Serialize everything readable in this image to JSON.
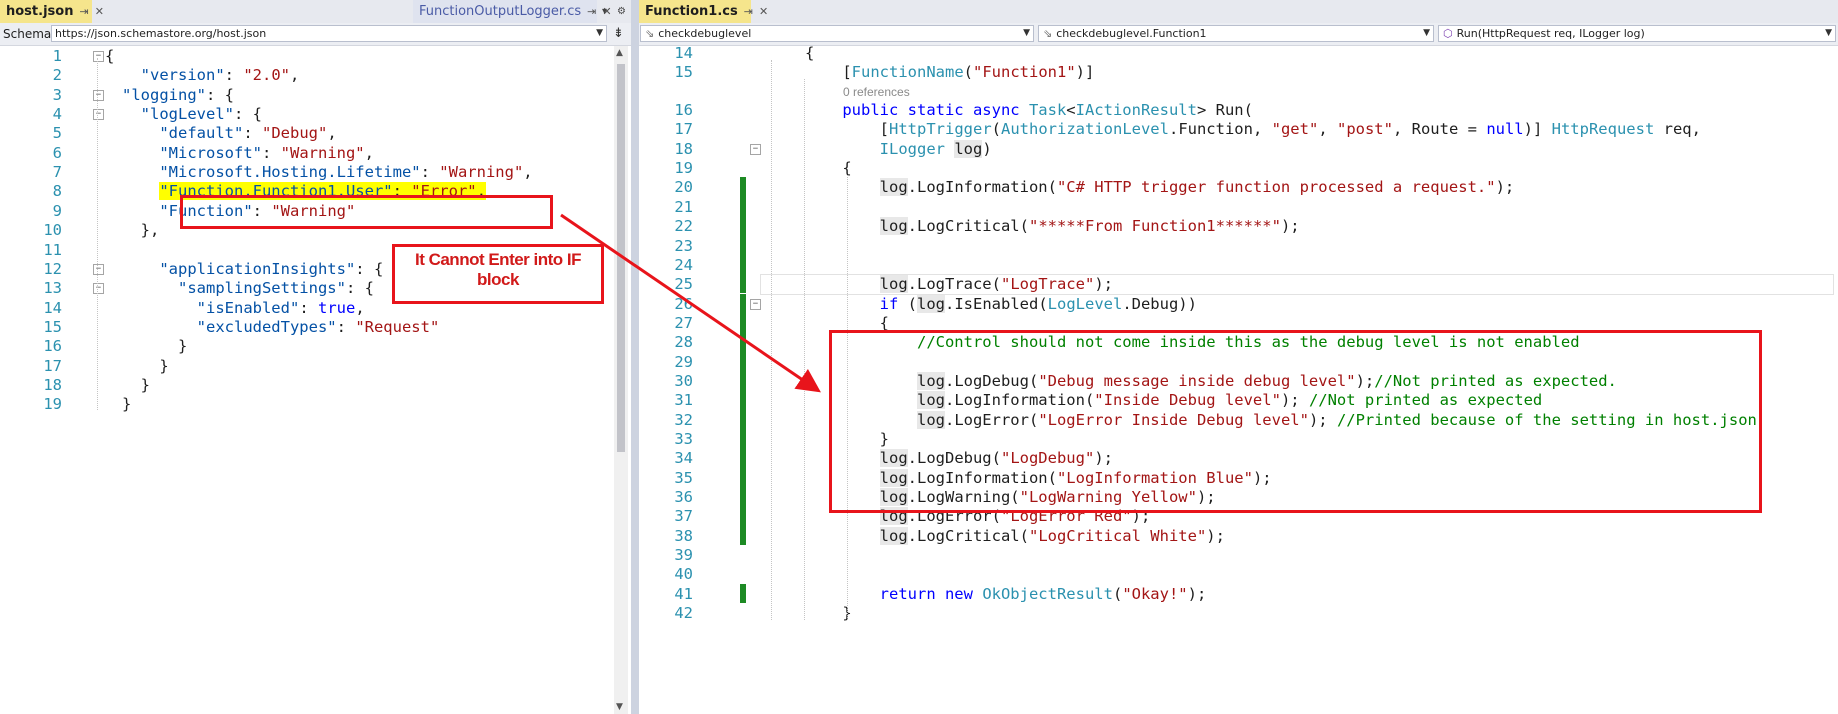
{
  "left": {
    "tabs": {
      "active": {
        "label": "host.json"
      },
      "other": {
        "label": "FunctionOutputLogger.cs"
      }
    },
    "schema": {
      "label": "Schema:",
      "value": "https://json.schemastore.org/host.json"
    },
    "lines": [
      {
        "n": "1",
        "tokens": [
          {
            "t": "{",
            "c": ""
          }
        ]
      },
      {
        "n": "2",
        "tokens": [
          {
            "t": "  \"version\"",
            "c": "j"
          },
          {
            "t": ": ",
            "c": ""
          },
          {
            "t": "\"2.0\"",
            "c": "s"
          },
          {
            "t": ",",
            "c": ""
          }
        ]
      },
      {
        "n": "3",
        "tokens": [
          {
            "t": "\"logging\"",
            "c": "j"
          },
          {
            "t": ": {",
            "c": ""
          }
        ]
      },
      {
        "n": "4",
        "tokens": [
          {
            "t": "  \"logLevel\"",
            "c": "j"
          },
          {
            "t": ": {",
            "c": ""
          }
        ]
      },
      {
        "n": "5",
        "tokens": [
          {
            "t": "    \"default\"",
            "c": "j"
          },
          {
            "t": ": ",
            "c": ""
          },
          {
            "t": "\"Debug\"",
            "c": "s"
          },
          {
            "t": ",",
            "c": ""
          }
        ]
      },
      {
        "n": "6",
        "tokens": [
          {
            "t": "    \"Microsoft\"",
            "c": "j"
          },
          {
            "t": ": ",
            "c": ""
          },
          {
            "t": "\"Warning\"",
            "c": "s"
          },
          {
            "t": ",",
            "c": ""
          }
        ]
      },
      {
        "n": "7",
        "tokens": [
          {
            "t": "    \"Microsoft.Hosting.Lifetime\"",
            "c": "j"
          },
          {
            "t": ": ",
            "c": ""
          },
          {
            "t": "\"Warning\"",
            "c": "s"
          },
          {
            "t": ",",
            "c": ""
          }
        ]
      },
      {
        "n": "8",
        "tokens": [
          {
            "t": "    ",
            "c": ""
          },
          {
            "t": "\"Function.Function1.User\"",
            "c": "j yel"
          },
          {
            "t": ": ",
            "c": "yel"
          },
          {
            "t": "\"Error\"",
            "c": "s yel"
          },
          {
            "t": ",",
            "c": "yel"
          }
        ]
      },
      {
        "n": "9",
        "tokens": [
          {
            "t": "    \"Function\"",
            "c": "j"
          },
          {
            "t": ": ",
            "c": ""
          },
          {
            "t": "\"Warning\"",
            "c": "s"
          }
        ]
      },
      {
        "n": "10",
        "tokens": [
          {
            "t": "  },",
            "c": ""
          }
        ]
      },
      {
        "n": "11",
        "tokens": []
      },
      {
        "n": "12",
        "tokens": [
          {
            "t": "    \"applicationInsights\"",
            "c": "j"
          },
          {
            "t": ": {",
            "c": ""
          }
        ]
      },
      {
        "n": "13",
        "tokens": [
          {
            "t": "      \"samplingSettings\"",
            "c": "j"
          },
          {
            "t": ": {",
            "c": ""
          }
        ]
      },
      {
        "n": "14",
        "tokens": [
          {
            "t": "        \"isEnabled\"",
            "c": "j"
          },
          {
            "t": ": ",
            "c": ""
          },
          {
            "t": "true",
            "c": "k"
          },
          {
            "t": ",",
            "c": ""
          }
        ]
      },
      {
        "n": "15",
        "tokens": [
          {
            "t": "        \"excludedTypes\"",
            "c": "j"
          },
          {
            "t": ": ",
            "c": ""
          },
          {
            "t": "\"Request\"",
            "c": "s"
          }
        ]
      },
      {
        "n": "16",
        "tokens": [
          {
            "t": "      }",
            "c": ""
          }
        ]
      },
      {
        "n": "17",
        "tokens": [
          {
            "t": "    }",
            "c": ""
          }
        ]
      },
      {
        "n": "18",
        "tokens": [
          {
            "t": "  }",
            "c": ""
          }
        ]
      },
      {
        "n": "19",
        "tokens": [
          {
            "t": "}",
            "c": ""
          }
        ]
      }
    ],
    "annotation": {
      "line1": "It Cannot Enter into IF",
      "line2": "block"
    }
  },
  "right": {
    "tabs": {
      "active": {
        "label": "Function1.cs"
      }
    },
    "nav": {
      "project": "checkdebuglevel",
      "type": "checkdebuglevel.Function1",
      "member": "Run(HttpRequest req, ILogger log)"
    },
    "codelens": "0 references",
    "lines": [
      {
        "n": "14",
        "tokens": [
          {
            "t": "{",
            "c": ""
          }
        ]
      },
      {
        "n": "15",
        "tokens": [
          {
            "t": "    [",
            "c": ""
          },
          {
            "t": "FunctionName",
            "c": "t"
          },
          {
            "t": "(",
            "c": ""
          },
          {
            "t": "\"Function1\"",
            "c": "s"
          },
          {
            "t": ")]",
            "c": ""
          }
        ]
      },
      {
        "n": "16",
        "tokens": [
          {
            "t": "    ",
            "c": ""
          },
          {
            "t": "public static async ",
            "c": "k"
          },
          {
            "t": "Task",
            "c": "t"
          },
          {
            "t": "<",
            "c": ""
          },
          {
            "t": "IActionResult",
            "c": "t"
          },
          {
            "t": "> ",
            "c": ""
          },
          {
            "t": "Run",
            "c": ""
          },
          {
            "t": "(",
            "c": ""
          }
        ]
      },
      {
        "n": "17",
        "tokens": [
          {
            "t": "        [",
            "c": ""
          },
          {
            "t": "HttpTrigger",
            "c": "t"
          },
          {
            "t": "(",
            "c": ""
          },
          {
            "t": "AuthorizationLevel",
            "c": "t"
          },
          {
            "t": ".Function, ",
            "c": ""
          },
          {
            "t": "\"get\"",
            "c": "s"
          },
          {
            "t": ", ",
            "c": ""
          },
          {
            "t": "\"post\"",
            "c": "s"
          },
          {
            "t": ", Route = ",
            "c": ""
          },
          {
            "t": "null",
            "c": "k"
          },
          {
            "t": ")] ",
            "c": ""
          },
          {
            "t": "HttpRequest",
            "c": "t"
          },
          {
            "t": " req,",
            "c": ""
          }
        ]
      },
      {
        "n": "18",
        "tokens": [
          {
            "t": "        ",
            "c": ""
          },
          {
            "t": "ILogger",
            "c": "t"
          },
          {
            "t": " ",
            "c": ""
          },
          {
            "t": "log",
            "c": "hl"
          },
          {
            "t": ")",
            "c": ""
          }
        ]
      },
      {
        "n": "19",
        "tokens": [
          {
            "t": "    {",
            "c": ""
          }
        ]
      },
      {
        "n": "20",
        "tokens": [
          {
            "t": "        ",
            "c": ""
          },
          {
            "t": "log",
            "c": "hl"
          },
          {
            "t": ".LogInformation(",
            "c": ""
          },
          {
            "t": "\"C# HTTP trigger function processed a request.\"",
            "c": "s"
          },
          {
            "t": ");",
            "c": ""
          }
        ]
      },
      {
        "n": "21",
        "tokens": []
      },
      {
        "n": "22",
        "tokens": [
          {
            "t": "        ",
            "c": ""
          },
          {
            "t": "log",
            "c": "hl"
          },
          {
            "t": ".LogCritical(",
            "c": ""
          },
          {
            "t": "\"*****From Function1******\"",
            "c": "s"
          },
          {
            "t": ");",
            "c": ""
          }
        ]
      },
      {
        "n": "23",
        "tokens": []
      },
      {
        "n": "24",
        "tokens": []
      },
      {
        "n": "25",
        "tokens": [
          {
            "t": "        ",
            "c": ""
          },
          {
            "t": "log",
            "c": "hl"
          },
          {
            "t": ".LogTrace(",
            "c": ""
          },
          {
            "t": "\"LogTrace\"",
            "c": "s"
          },
          {
            "t": ");",
            "c": ""
          }
        ]
      },
      {
        "n": "26",
        "tokens": [
          {
            "t": "        ",
            "c": ""
          },
          {
            "t": "if",
            "c": "k"
          },
          {
            "t": " (",
            "c": ""
          },
          {
            "t": "log",
            "c": "hl"
          },
          {
            "t": ".IsEnabled(",
            "c": ""
          },
          {
            "t": "LogLevel",
            "c": "t"
          },
          {
            "t": ".Debug))",
            "c": ""
          }
        ]
      },
      {
        "n": "27",
        "tokens": [
          {
            "t": "        {",
            "c": ""
          }
        ]
      },
      {
        "n": "28",
        "tokens": [
          {
            "t": "            ",
            "c": ""
          },
          {
            "t": "//Control should not come inside this as the debug level is not enabled",
            "c": "c"
          }
        ]
      },
      {
        "n": "29",
        "tokens": []
      },
      {
        "n": "30",
        "tokens": [
          {
            "t": "            ",
            "c": ""
          },
          {
            "t": "log",
            "c": "hl"
          },
          {
            "t": ".LogDebug(",
            "c": ""
          },
          {
            "t": "\"Debug message inside debug level\"",
            "c": "s"
          },
          {
            "t": ");",
            "c": ""
          },
          {
            "t": "//Not printed as expected.",
            "c": "c"
          }
        ]
      },
      {
        "n": "31",
        "tokens": [
          {
            "t": "            ",
            "c": ""
          },
          {
            "t": "log",
            "c": "hl"
          },
          {
            "t": ".LogInformation(",
            "c": ""
          },
          {
            "t": "\"Inside Debug level\"",
            "c": "s"
          },
          {
            "t": "); ",
            "c": ""
          },
          {
            "t": "//Not printed as expected",
            "c": "c"
          }
        ]
      },
      {
        "n": "32",
        "tokens": [
          {
            "t": "            ",
            "c": ""
          },
          {
            "t": "log",
            "c": "hl"
          },
          {
            "t": ".LogError(",
            "c": ""
          },
          {
            "t": "\"LogError Inside Debug level\"",
            "c": "s"
          },
          {
            "t": "); ",
            "c": ""
          },
          {
            "t": "//Printed because of the setting in host.json",
            "c": "c"
          }
        ]
      },
      {
        "n": "33",
        "tokens": [
          {
            "t": "        }",
            "c": ""
          }
        ]
      },
      {
        "n": "34",
        "tokens": [
          {
            "t": "        ",
            "c": ""
          },
          {
            "t": "log",
            "c": "hl"
          },
          {
            "t": ".LogDebug(",
            "c": ""
          },
          {
            "t": "\"LogDebug\"",
            "c": "s"
          },
          {
            "t": ");",
            "c": ""
          }
        ]
      },
      {
        "n": "35",
        "tokens": [
          {
            "t": "        ",
            "c": ""
          },
          {
            "t": "log",
            "c": "hl"
          },
          {
            "t": ".LogInformation(",
            "c": ""
          },
          {
            "t": "\"LogInformation Blue\"",
            "c": "s"
          },
          {
            "t": ");",
            "c": ""
          }
        ]
      },
      {
        "n": "36",
        "tokens": [
          {
            "t": "        ",
            "c": ""
          },
          {
            "t": "log",
            "c": "hl"
          },
          {
            "t": ".LogWarning(",
            "c": ""
          },
          {
            "t": "\"LogWarning Yellow\"",
            "c": "s"
          },
          {
            "t": ");",
            "c": ""
          }
        ]
      },
      {
        "n": "37",
        "tokens": [
          {
            "t": "        ",
            "c": ""
          },
          {
            "t": "log",
            "c": "hl"
          },
          {
            "t": ".LogError(",
            "c": ""
          },
          {
            "t": "\"LogError Red\"",
            "c": "s"
          },
          {
            "t": ");",
            "c": ""
          }
        ]
      },
      {
        "n": "38",
        "tokens": [
          {
            "t": "        ",
            "c": ""
          },
          {
            "t": "log",
            "c": "hl"
          },
          {
            "t": ".LogCritical(",
            "c": ""
          },
          {
            "t": "\"LogCritical White\"",
            "c": "s"
          },
          {
            "t": ");",
            "c": ""
          }
        ]
      },
      {
        "n": "39",
        "tokens": []
      },
      {
        "n": "40",
        "tokens": []
      },
      {
        "n": "41",
        "tokens": [
          {
            "t": "        ",
            "c": ""
          },
          {
            "t": "return new ",
            "c": "k"
          },
          {
            "t": "OkObjectResult",
            "c": "t"
          },
          {
            "t": "(",
            "c": ""
          },
          {
            "t": "\"Okay!\"",
            "c": "s"
          },
          {
            "t": ");",
            "c": ""
          }
        ]
      },
      {
        "n": "42",
        "tokens": [
          {
            "t": "    }",
            "c": ""
          }
        ]
      }
    ]
  },
  "colors": {
    "keyword": "#0000ff",
    "type": "#2b91af",
    "string": "#a31515",
    "comment": "#008000",
    "json_key": "#0451a5",
    "line_number": "#2b91af",
    "annotation_red": "#e8141b",
    "highlight_yellow": "#ffff00",
    "change_bar_green": "#1d8a24",
    "active_tab": "#f5e58c"
  }
}
